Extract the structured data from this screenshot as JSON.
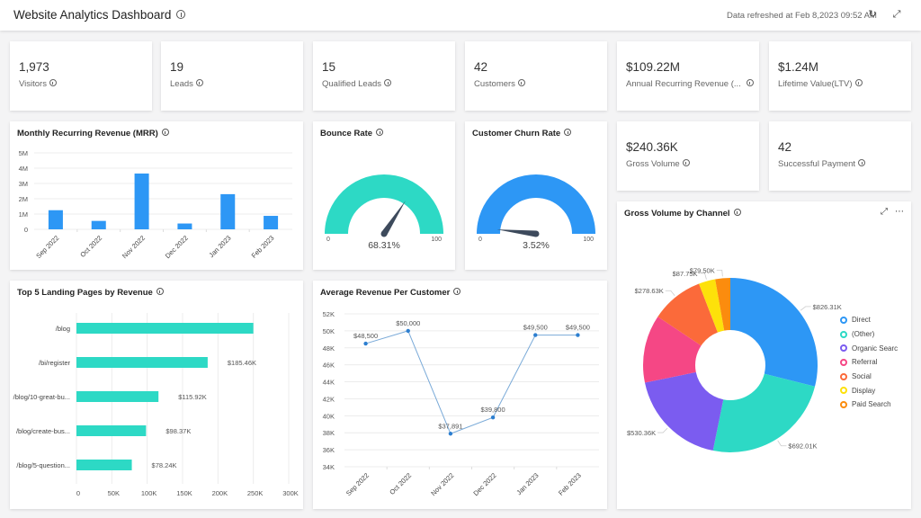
{
  "header": {
    "title": "Website Analytics Dashboard",
    "refreshed": "Data refreshed at Feb 8,2023 09:52 AM",
    "refresh_icon": "refresh-icon",
    "collapse_icon": "collapse-icon"
  },
  "kpis": [
    {
      "value": "1,973",
      "label": "Visitors"
    },
    {
      "value": "19",
      "label": "Leads"
    },
    {
      "value": "15",
      "label": "Qualified Leads"
    },
    {
      "value": "42",
      "label": "Customers"
    },
    {
      "value": "$109.22M",
      "label": "Annual Recurring Revenue (..."
    },
    {
      "value": "$1.24M",
      "label": "Lifetime Value(LTV)"
    },
    {
      "value": "$240.36K",
      "label": "Gross Volume"
    },
    {
      "value": "42",
      "label": "Successful Payment"
    }
  ],
  "gauges": {
    "bounce": {
      "title": "Bounce Rate",
      "value": 68.31,
      "display": "68.31%",
      "min": "0",
      "max": "100",
      "color": "#2dd9c5"
    },
    "churn": {
      "title": "Customer Churn Rate",
      "value": 3.52,
      "display": "3.52%",
      "min": "0",
      "max": "100",
      "color": "#2d97f5"
    }
  },
  "chart_data": [
    {
      "id": "mrr",
      "type": "bar",
      "title": "Monthly Recurring Revenue (MRR)",
      "categories": [
        "Sep 2022",
        "Oct 2022",
        "Nov 2022",
        "Dec 2022",
        "Jan 2023",
        "Feb 2023"
      ],
      "values": [
        1250000,
        550000,
        3650000,
        380000,
        2300000,
        880000
      ],
      "yticks": [
        "0",
        "1M",
        "2M",
        "3M",
        "4M",
        "5M"
      ],
      "ylim": [
        0,
        5000000
      ],
      "color": "#2d97f5",
      "grid": true
    },
    {
      "id": "landing",
      "type": "bar",
      "orientation": "horizontal",
      "title": "Top 5 Landing Pages by Revenue",
      "categories": [
        "/blog",
        "/bi/register",
        "/blog/10-great-bu...",
        "/blog/create-bus...",
        "/blog/5-question..."
      ],
      "values": [
        250000,
        185460,
        115920,
        98370,
        78240
      ],
      "labels": [
        "",
        "$185.46K",
        "$115.92K",
        "$98.37K",
        "$78.24K"
      ],
      "xticks": [
        "0",
        "50K",
        "100K",
        "150K",
        "200K",
        "250K",
        "300K"
      ],
      "xlim": [
        0,
        300000
      ],
      "color": "#2dd9c5",
      "grid": true
    },
    {
      "id": "arpc",
      "type": "line",
      "title": "Average Revenue Per Customer",
      "categories": [
        "Sep 2022",
        "Oct 2022",
        "Nov 2022",
        "Dec 2022",
        "Jan 2023",
        "Feb 2023"
      ],
      "values": [
        48500,
        50000,
        37891,
        39800,
        49500,
        49500
      ],
      "labels": [
        "$48,500",
        "$50,000",
        "$37,891",
        "$39,800",
        "$49,500",
        "$49,500"
      ],
      "yticks": [
        "34K",
        "36K",
        "38K",
        "40K",
        "42K",
        "44K",
        "46K",
        "48K",
        "50K",
        "52K"
      ],
      "ylim": [
        34000,
        52000
      ],
      "color": "#2d7fd0",
      "grid": true
    },
    {
      "id": "channel",
      "type": "pie",
      "donut": true,
      "title": "Gross Volume by Channel",
      "slices": [
        {
          "name": "Direct",
          "value": 826310,
          "label": "$826.31K",
          "color": "#2d97f5"
        },
        {
          "name": "(Other)",
          "value": 692010,
          "label": "$692.01K",
          "color": "#2dd9c5"
        },
        {
          "name": "Organic Searc",
          "value": 530360,
          "label": "$530.36K",
          "color": "#7b5cf0"
        },
        {
          "name": "Referral",
          "value": 360000,
          "label": "",
          "color": "#f54785"
        },
        {
          "name": "Social",
          "value": 278630,
          "label": "$278.63K",
          "color": "#fb6a3a"
        },
        {
          "name": "Display",
          "value": 87750,
          "label": "$87.75K",
          "color": "#fde10a"
        },
        {
          "name": "Paid Search",
          "value": 79500,
          "label": "$79.50K",
          "color": "#fb8c0e"
        }
      ],
      "legend": "right"
    }
  ],
  "channel_card": {
    "expand_icon": "expand-icon",
    "more_icon": "more-icon"
  }
}
